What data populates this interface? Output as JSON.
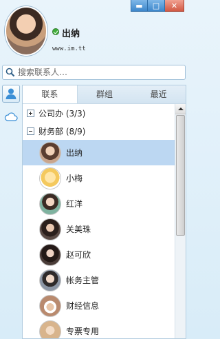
{
  "window": {
    "min_glyph": "▬",
    "max_glyph": "□",
    "close_glyph": "✕"
  },
  "profile": {
    "name": "出纳",
    "site": "www.im.tt",
    "status": "online"
  },
  "search": {
    "placeholder": "搜索联系人…"
  },
  "tabs": [
    {
      "label": "联系",
      "active": true
    },
    {
      "label": "群组",
      "active": false
    },
    {
      "label": "最近",
      "active": false
    }
  ],
  "groups": [
    {
      "label": "公司办 (3/3)",
      "expanded": false
    },
    {
      "label": "财务部 (8/9)",
      "expanded": true
    }
  ],
  "contacts": [
    {
      "name": "出纳",
      "selected": true,
      "avatar_color": "#c9a58c"
    },
    {
      "name": "小梅",
      "selected": false,
      "avatar_color": "#f4d35e"
    },
    {
      "name": "红洋",
      "selected": false,
      "avatar_color": "#7fb3a0"
    },
    {
      "name": "关美珠",
      "selected": false,
      "avatar_color": "#5a4a44"
    },
    {
      "name": "赵可欣",
      "selected": false,
      "avatar_color": "#4a3c38"
    },
    {
      "name": "帐务主管",
      "selected": false,
      "avatar_color": "#8c96a5"
    },
    {
      "name": "财经信息",
      "selected": false,
      "avatar_color": "#b98a6e"
    },
    {
      "name": "专票专用",
      "selected": false,
      "avatar_color": "#d8b48c"
    }
  ]
}
